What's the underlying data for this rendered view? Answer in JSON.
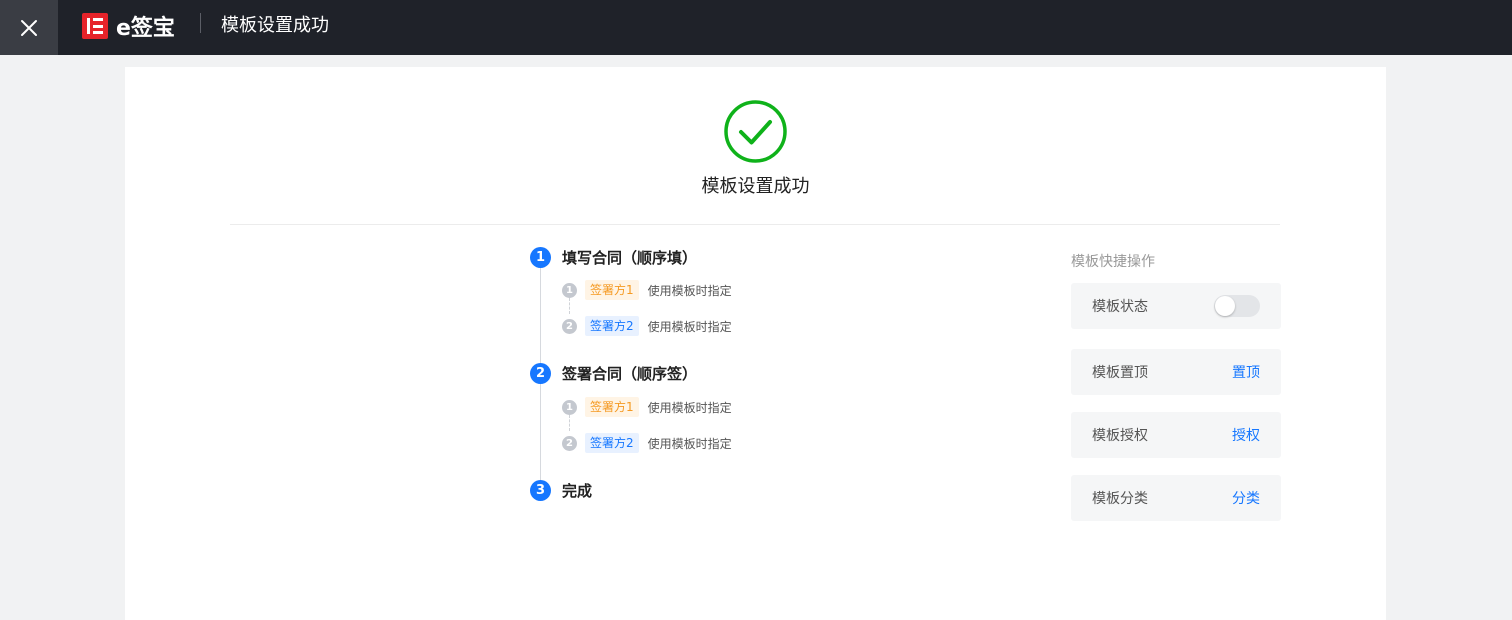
{
  "header": {
    "logo_text": "e签宝",
    "title": "模板设置成功",
    "close_icon": "close-icon"
  },
  "result": {
    "title": "模板设置成功",
    "icon": "check-circle-icon",
    "color": "#0fb21a"
  },
  "steps": [
    {
      "number": "1",
      "title": "填写合同（顺序填）",
      "subs": [
        {
          "number": "1",
          "tag": "签署方1",
          "tag_color": "orange",
          "text": "使用模板时指定"
        },
        {
          "number": "2",
          "tag": "签署方2",
          "tag_color": "blue",
          "text": "使用模板时指定"
        }
      ]
    },
    {
      "number": "2",
      "title": "签署合同（顺序签）",
      "subs": [
        {
          "number": "1",
          "tag": "签署方1",
          "tag_color": "orange",
          "text": "使用模板时指定"
        },
        {
          "number": "2",
          "tag": "签署方2",
          "tag_color": "blue",
          "text": "使用模板时指定"
        }
      ]
    },
    {
      "number": "3",
      "title": "完成",
      "subs": []
    }
  ],
  "quick_actions": {
    "title": "模板快捷操作",
    "items": [
      {
        "label": "模板状态",
        "type": "toggle",
        "enabled": false
      },
      {
        "label": "模板置顶",
        "type": "link",
        "action": "置顶"
      },
      {
        "label": "模板授权",
        "type": "link",
        "action": "授权"
      },
      {
        "label": "模板分类",
        "type": "link",
        "action": "分类"
      }
    ]
  },
  "colors": {
    "accent": "#1677ff",
    "success": "#0fb21a",
    "brand": "#e6232a",
    "topbar": "#1f2229"
  }
}
